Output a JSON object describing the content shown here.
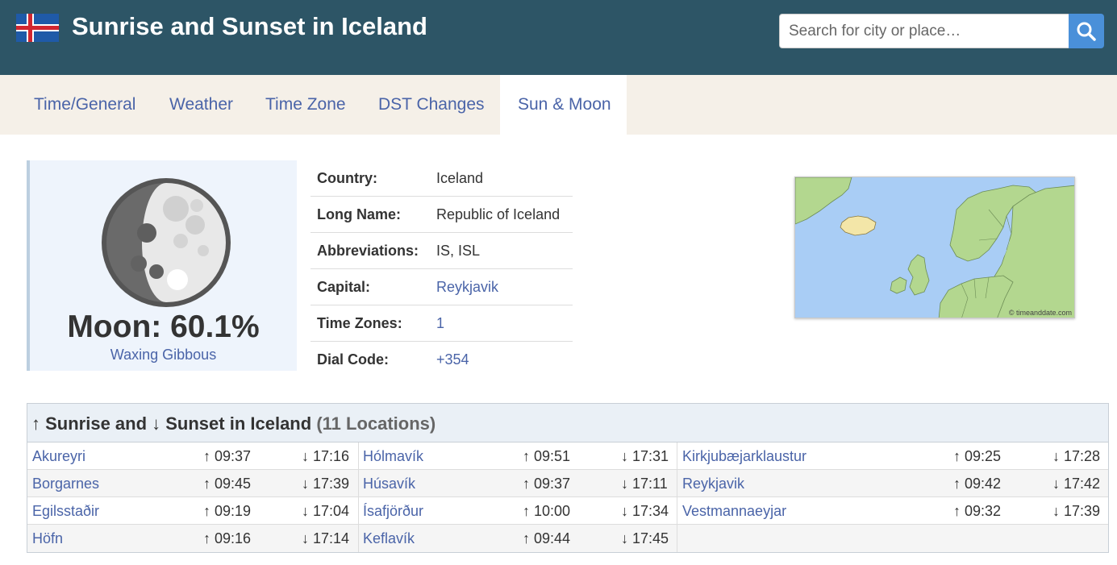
{
  "header": {
    "title": "Sunrise and Sunset in Iceland",
    "search_placeholder": "Search for city or place…",
    "search_icon": "magnifier-icon",
    "flag_icon": "iceland-flag-icon",
    "colors": {
      "header_bg": "#2d5566",
      "search_button": "#4a90d9"
    }
  },
  "tabs": [
    {
      "label": "Time/General",
      "active": false
    },
    {
      "label": "Weather",
      "active": false
    },
    {
      "label": "Time Zone",
      "active": false
    },
    {
      "label": "DST Changes",
      "active": false
    },
    {
      "label": "Sun & Moon",
      "active": true
    }
  ],
  "moon": {
    "title": "Moon: 60.1%",
    "phase": "Waxing Gibbous",
    "illumination_fraction": 0.601
  },
  "info": [
    {
      "label": "Country:",
      "value": "Iceland",
      "link": false
    },
    {
      "label": "Long Name:",
      "value": "Republic of Iceland",
      "link": false
    },
    {
      "label": "Abbreviations:",
      "value": "IS, ISL",
      "link": false
    },
    {
      "label": "Capital:",
      "value": "Reykjavik",
      "link": true
    },
    {
      "label": "Time Zones:",
      "value": "1",
      "link": true
    },
    {
      "label": "Dial Code:",
      "value": "+354",
      "link": true
    }
  ],
  "map": {
    "credit": "© timeanddate.com"
  },
  "sun_table": {
    "heading_up": "↑ Sunrise and ↓ Sunset in Iceland",
    "count": "(11 Locations)",
    "rows": [
      [
        {
          "city": "Akureyri",
          "rise": "↑ 09:37",
          "set": "↓ 17:16"
        },
        {
          "city": "Hólmavík",
          "rise": "↑ 09:51",
          "set": "↓ 17:31"
        },
        {
          "city": "Kirkjubæjarklaustur",
          "rise": "↑ 09:25",
          "set": "↓ 17:28"
        }
      ],
      [
        {
          "city": "Borgarnes",
          "rise": "↑ 09:45",
          "set": "↓ 17:39"
        },
        {
          "city": "Húsavík",
          "rise": "↑ 09:37",
          "set": "↓ 17:11"
        },
        {
          "city": "Reykjavik",
          "rise": "↑ 09:42",
          "set": "↓ 17:42"
        }
      ],
      [
        {
          "city": "Egilsstaðir",
          "rise": "↑ 09:19",
          "set": "↓ 17:04"
        },
        {
          "city": "Ísafjörður",
          "rise": "↑ 10:00",
          "set": "↓ 17:34"
        },
        {
          "city": "Vestmannaeyjar",
          "rise": "↑ 09:32",
          "set": "↓ 17:39"
        }
      ],
      [
        {
          "city": "Höfn",
          "rise": "↑ 09:16",
          "set": "↓ 17:14"
        },
        {
          "city": "Keflavík",
          "rise": "↑ 09:44",
          "set": "↓ 17:45"
        }
      ]
    ]
  }
}
